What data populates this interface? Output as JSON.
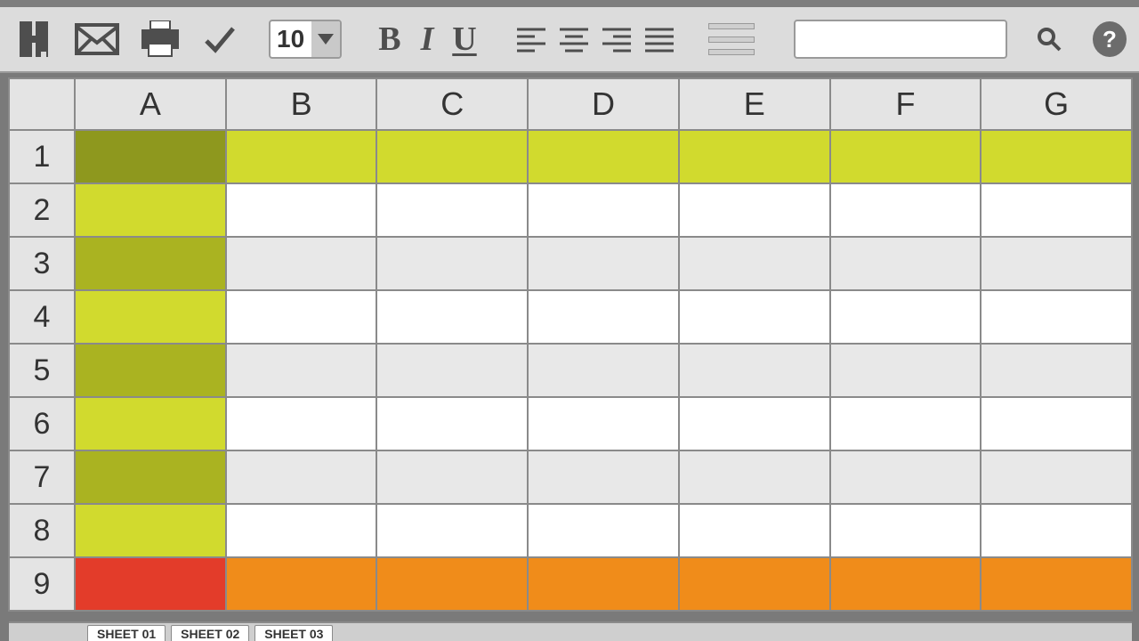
{
  "toolbar": {
    "font_size": "10",
    "bold_label": "B",
    "italic_label": "I",
    "underline_label": "U",
    "help_label": "?"
  },
  "search": {
    "value": "",
    "placeholder": ""
  },
  "columns": [
    "A",
    "B",
    "C",
    "D",
    "E",
    "F",
    "G"
  ],
  "rows": [
    "1",
    "2",
    "3",
    "4",
    "5",
    "6",
    "7",
    "8",
    "9"
  ],
  "sheet_tabs": [
    "SHEET 01",
    "SHEET 02",
    "SHEET 03"
  ],
  "highlight": {
    "selected_cell": "A1",
    "column_A_fill": "yellow",
    "row_1_fill": "yellow",
    "row_9_fill": "orange",
    "A9_fill": "red"
  }
}
